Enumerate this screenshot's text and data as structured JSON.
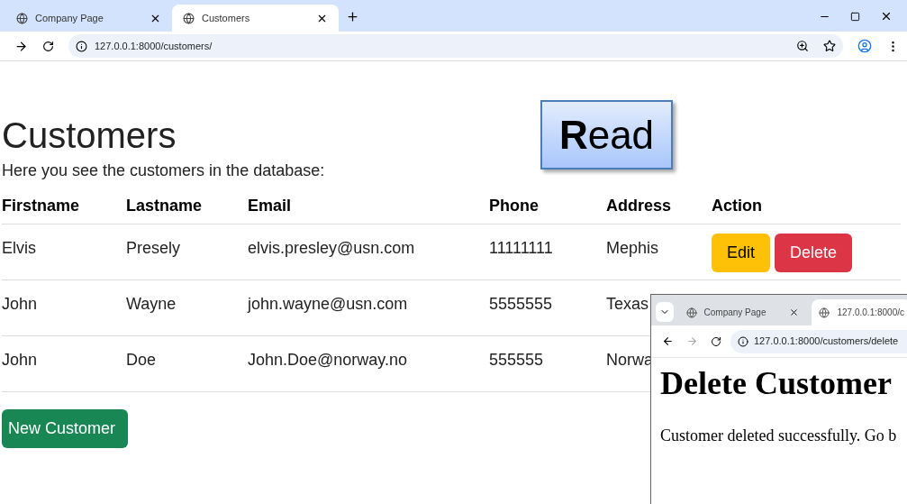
{
  "browser": {
    "tabs": [
      {
        "title": "Company Page",
        "selected": false
      },
      {
        "title": "Customers",
        "selected": true
      }
    ],
    "url": "127.0.0.1:8000/customers/"
  },
  "page": {
    "heading": "Customers",
    "intro": "Here you see the customers in the database:",
    "table": {
      "columns": [
        "Firstname",
        "Lastname",
        "Email",
        "Phone",
        "Address",
        "Action"
      ],
      "rows": [
        {
          "cells": [
            "Elvis",
            "Presely",
            "elvis.presley@usn.com",
            "11111111",
            "Mephis"
          ],
          "actions": [
            {
              "label": "Edit",
              "kind": "edit"
            },
            {
              "label": "Delete",
              "kind": "delete"
            }
          ]
        },
        {
          "cells": [
            "John",
            "Wayne",
            "john.wayne@usn.com",
            "5555555",
            "Texas"
          ],
          "actions": []
        },
        {
          "cells": [
            "John",
            "Doe",
            "John.Doe@norway.no",
            "555555",
            "Norwa"
          ],
          "actions": []
        }
      ]
    },
    "new_button": "New Customer"
  },
  "callout": "**R**ead",
  "second_window": {
    "tabs": [
      {
        "title": "Company Page",
        "selected": false
      },
      {
        "title": "127.0.0.1:8000/c",
        "selected": true
      }
    ],
    "url": "127.0.0.1:8000/customers/delete",
    "heading": "Delete Customer",
    "message": "Customer deleted successfully. Go b"
  }
}
